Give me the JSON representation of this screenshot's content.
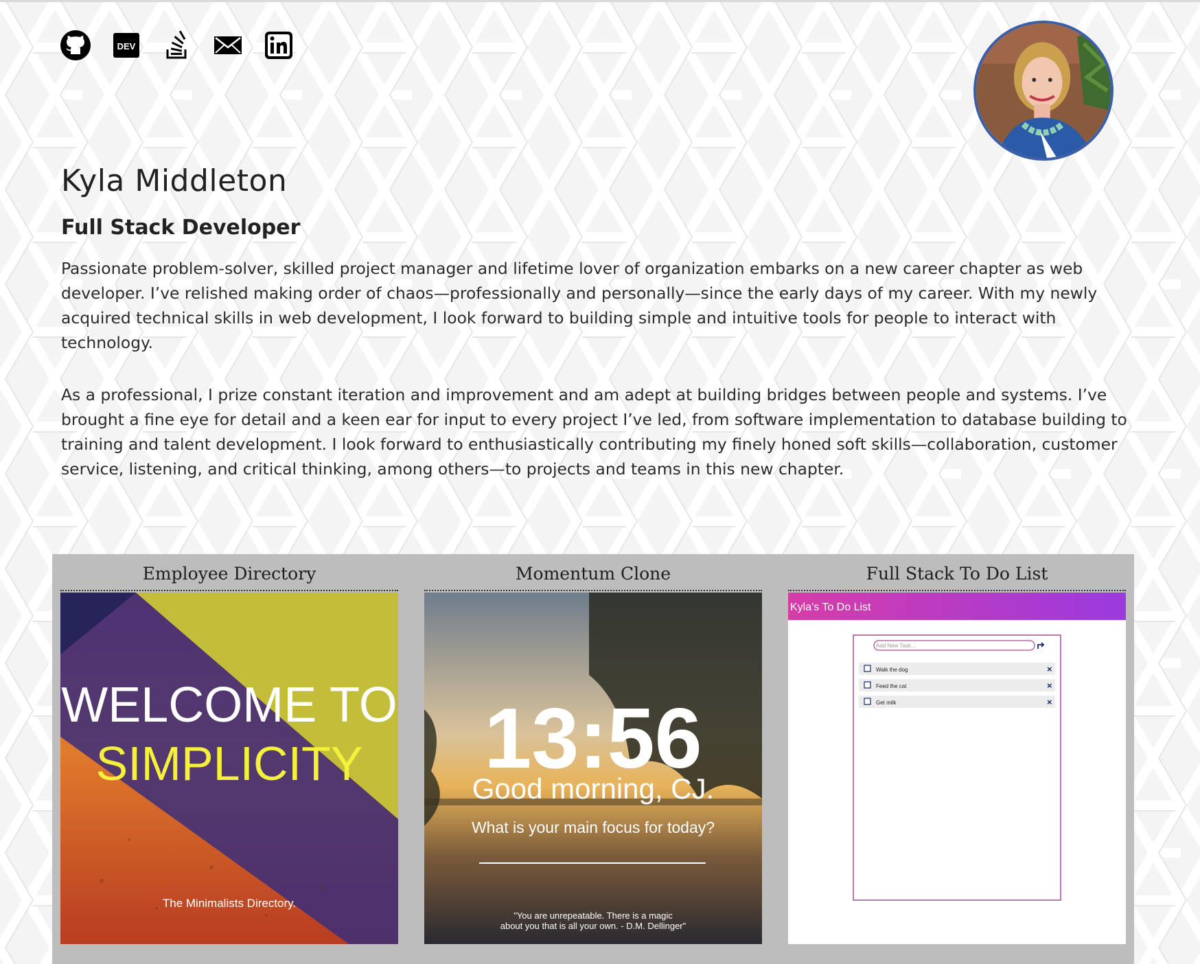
{
  "social": [
    {
      "name": "github-icon",
      "label": "GitHub"
    },
    {
      "name": "dev-icon",
      "label": "DEV"
    },
    {
      "name": "stackoverflow-icon",
      "label": "Stack Overflow"
    },
    {
      "name": "email-icon",
      "label": "Email"
    },
    {
      "name": "linkedin-icon",
      "label": "LinkedIn"
    }
  ],
  "profile": {
    "name": "Kyla Middleton",
    "role": "Full Stack Developer",
    "bio": [
      "Passionate problem-solver, skilled project manager and lifetime lover of organization embarks on a new career chapter as web developer. I’ve relished making order of chaos—professionally and personally—since the early days of my career. With my newly acquired technical skills in web development, I look forward to building simple and intuitive tools for people to interact with technology.",
      "As a professional, I prize constant iteration and improvement and am adept at building bridges between people and systems. I’ve brought a fine eye for detail and a keen ear for input to every project I’ve led, from software implementation to database building to training and talent development. I look forward to enthusiastically contributing my finely honed soft skills—collaboration, customer service, listening, and critical thinking, among others—to projects and teams in this new chapter."
    ]
  },
  "projects": [
    {
      "title": "Employee Directory",
      "thumb": {
        "line1": "WELCOME TO",
        "line2": "SIMPLICITY",
        "caption": "The Minimalists Directory."
      }
    },
    {
      "title": "Momentum Clone",
      "thumb": {
        "time": "13:56",
        "greeting": "Good morning, CJ.",
        "prompt": "What is your main focus for today?",
        "quote_line1": "\"You are unrepeatable.  There is a magic",
        "quote_line2": "about you that is all your own. - D.M. Dellinger\""
      }
    },
    {
      "title": "Full Stack To Do List",
      "thumb": {
        "header": "Kyla's To Do List",
        "placeholder": "Add New Task...",
        "tasks": [
          "Walk the dog",
          "Feed the cat",
          "Get milk"
        ],
        "delete_glyph": "×"
      }
    }
  ],
  "colors": {
    "accent_border": "#3a5ea8",
    "portfolio_bg": "#bdbdbd",
    "todo_gradient_start": "#d63ca8",
    "todo_gradient_end": "#9a3ae0"
  }
}
